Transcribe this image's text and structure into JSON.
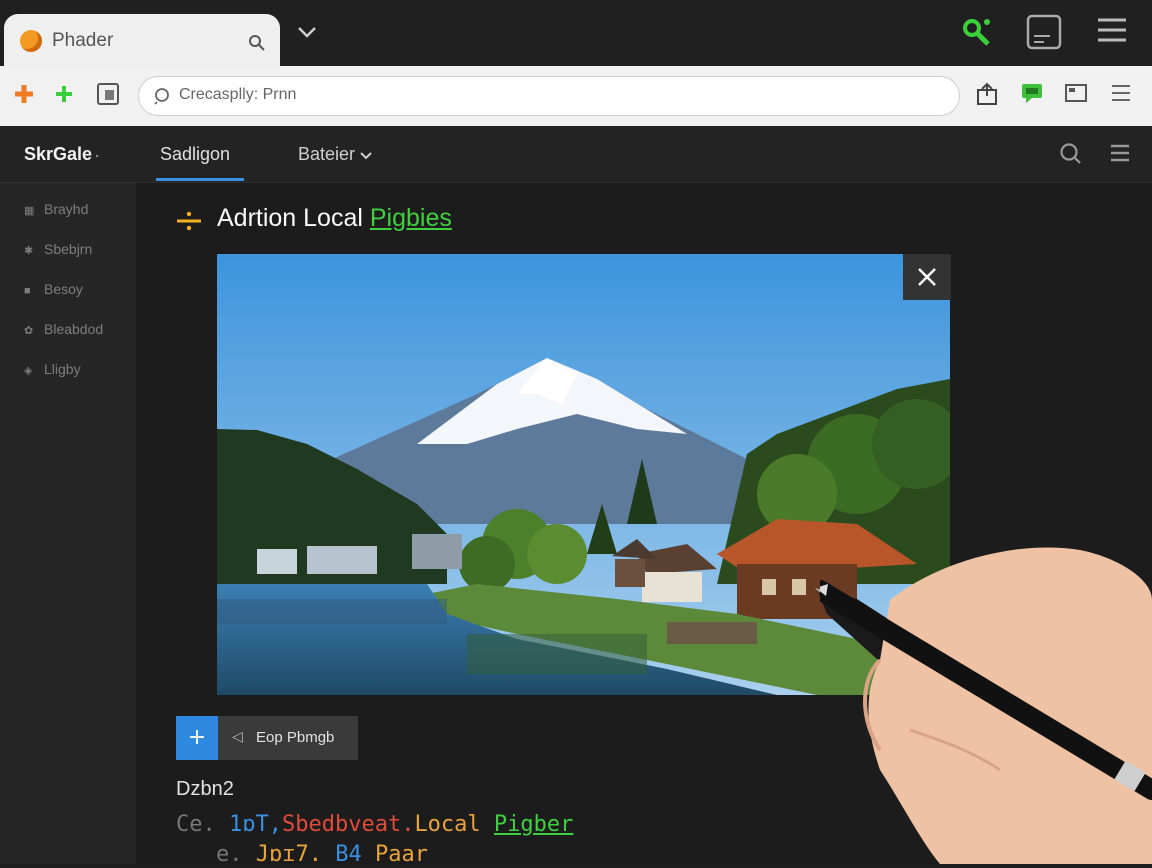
{
  "browser": {
    "tab_title": "Phader",
    "omnibox_text": "Crecasplly: Prnn"
  },
  "app": {
    "brand": "SkrGale",
    "tabs": [
      {
        "label": "Sadligon"
      },
      {
        "label": "Bateier"
      }
    ]
  },
  "sidebar": {
    "items": [
      {
        "label": "Brayhd"
      },
      {
        "label": "Sbebjrn"
      },
      {
        "label": "Besoy"
      },
      {
        "label": "Bleabdod"
      },
      {
        "label": "Lligby"
      }
    ]
  },
  "content": {
    "title_main": "Adrtion  Local ",
    "title_link": "Pigbies",
    "add_button_label": "+",
    "secondary_button_label": "Eop Pbmgb",
    "section_label": "Dzbn2",
    "code_line1": {
      "prefix": "Ce.",
      "part1": "1ɒT,",
      "part2": "Sbedbveat.",
      "part3": "Local",
      "part4": "Pigber"
    },
    "code_line2": {
      "prefix": "e.",
      "part1": "Jɒɪ7.",
      "part2": "B4",
      "part3": "Paar"
    }
  },
  "colors": {
    "accent_blue": "#2d8ae0",
    "link_green": "#3fcf3f",
    "tab_favicon": "#f39a22"
  }
}
